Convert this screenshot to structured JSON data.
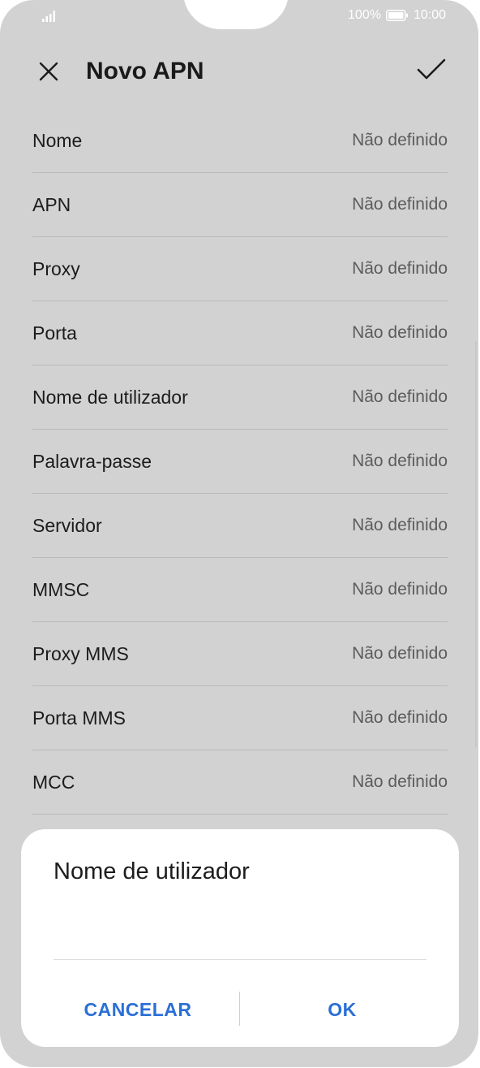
{
  "status_bar": {
    "battery_percent": "100%",
    "time": "10:00",
    "icons": [
      "signal-icon",
      "battery-icon"
    ]
  },
  "app_bar": {
    "title": "Novo APN",
    "close_icon": "close-icon",
    "confirm_icon": "checkmark-icon"
  },
  "apn_fields": [
    {
      "label": "Nome",
      "value": "Não definido"
    },
    {
      "label": "APN",
      "value": "Não definido"
    },
    {
      "label": "Proxy",
      "value": "Não definido"
    },
    {
      "label": "Porta",
      "value": "Não definido"
    },
    {
      "label": "Nome de utilizador",
      "value": "Não definido"
    },
    {
      "label": "Palavra-passe",
      "value": "Não definido"
    },
    {
      "label": "Servidor",
      "value": "Não definido"
    },
    {
      "label": "MMSC",
      "value": "Não definido"
    },
    {
      "label": "Proxy MMS",
      "value": "Não definido"
    },
    {
      "label": "Porta MMS",
      "value": "Não definido"
    },
    {
      "label": "MCC",
      "value": "Não definido"
    }
  ],
  "dialog": {
    "title": "Nome de utilizador",
    "input_value": "",
    "cancel_label": "CANCELAR",
    "ok_label": "OK"
  },
  "colors": {
    "accent": "#2a6fd6",
    "dimmed_background": "#d2d2d2",
    "dialog_background": "#ffffff"
  }
}
